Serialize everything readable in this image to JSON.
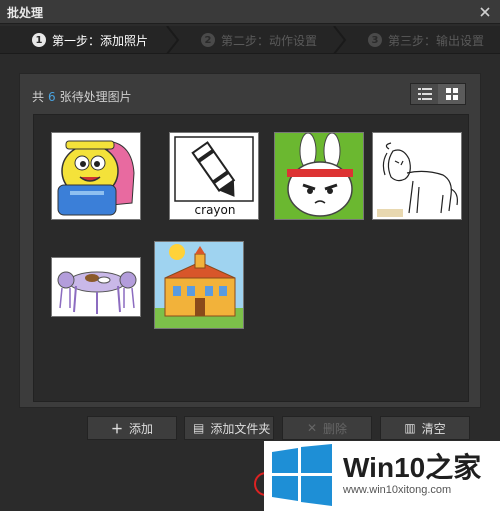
{
  "window": {
    "title": "批处理"
  },
  "steps": [
    {
      "num": "1",
      "label": "第一步：添加照片"
    },
    {
      "num": "2",
      "label": "第二步：动作设置"
    },
    {
      "num": "3",
      "label": "第三步：输出设置"
    }
  ],
  "panel": {
    "count_prefix": "共",
    "count": "6",
    "count_suffix": "张待处理图片"
  },
  "thumbnails": [
    {
      "name": "backpack",
      "text": ""
    },
    {
      "name": "crayon",
      "text": "crayon"
    },
    {
      "name": "rabbit",
      "text": ""
    },
    {
      "name": "lion",
      "text": ""
    },
    {
      "name": "table",
      "text": ""
    },
    {
      "name": "school",
      "text": ""
    }
  ],
  "buttons": {
    "add": "添加",
    "add_folder": "添加文件夹",
    "delete": "删除",
    "clear": "清空"
  },
  "watermark": {
    "brand": "Win10",
    "brand_cn": "之家",
    "url": "www.win10xitong.com"
  },
  "colors": {
    "accent": "#4aa3e0",
    "win_blue": "#1e8fd6"
  }
}
